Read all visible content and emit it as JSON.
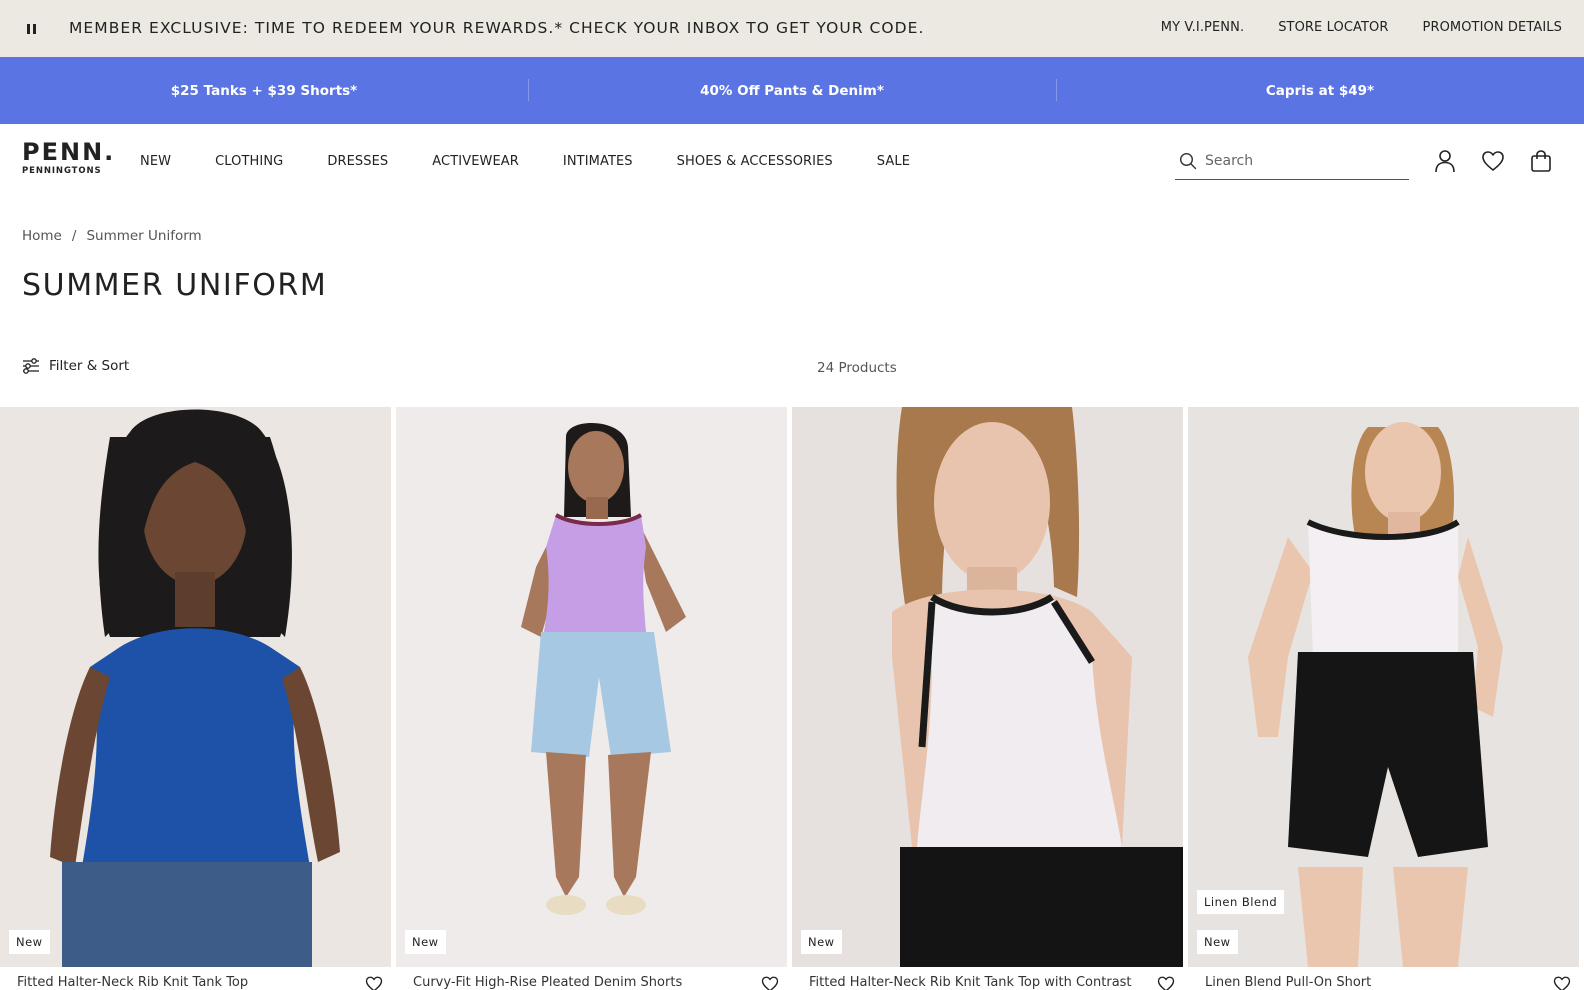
{
  "top_banner": {
    "message": "MEMBER EXCLUSIVE: TIME TO REDEEM YOUR REWARDS.* CHECK YOUR INBOX TO GET YOUR CODE.",
    "links": [
      "MY V.I.PENN.",
      "STORE LOCATOR",
      "PROMOTION DETAILS"
    ],
    "background": "#ece9e3"
  },
  "promo_bar": {
    "items": [
      "$25 Tanks + $39 Shorts*",
      "40% Off Pants & Denim*",
      "Capris at $49*"
    ],
    "background": "#5b74e3"
  },
  "header": {
    "logo": {
      "main": "PENN.",
      "sub": "PENNINGTONS"
    },
    "nav": [
      "NEW",
      "CLOTHING",
      "DRESSES",
      "ACTIVEWEAR",
      "INTIMATES",
      "SHOES & ACCESSORIES",
      "SALE"
    ],
    "search": {
      "placeholder": "Search",
      "icon": "search-icon"
    },
    "icons": [
      "account-icon",
      "wishlist-heart-icon",
      "shopping-bag-icon"
    ]
  },
  "breadcrumb": {
    "items": [
      "Home",
      "Summer Uniform"
    ],
    "separator": "/"
  },
  "page_title": "SUMMER UNIFORM",
  "toolbar": {
    "filter_label": "Filter & Sort",
    "product_count": "24 Products"
  },
  "products": [
    {
      "name": "Fitted Halter-Neck Rib Knit Tank Top",
      "badges": [
        "New"
      ],
      "top_color": "#1e52a8",
      "bottom_color": "#3d5d88",
      "background": "#ece6e2"
    },
    {
      "name": "Curvy-Fit High-Rise Pleated Denim Shorts",
      "badges": [
        "New"
      ],
      "top_color": "#c69ee6",
      "bottom_color": "#a6c8e3",
      "background": "#efebea"
    },
    {
      "name": "Fitted Halter-Neck Rib Knit Tank Top with Contrast",
      "badges": [
        "New"
      ],
      "top_color": "#f1ecef",
      "bottom_color": "#141414",
      "background": "#e6e1df"
    },
    {
      "name": "Linen Blend Pull-On Short",
      "badges": [
        "Linen Blend",
        "New"
      ],
      "top_color": "#f3eff3",
      "bottom_color": "#151515",
      "background": "#e7e3e1"
    }
  ]
}
